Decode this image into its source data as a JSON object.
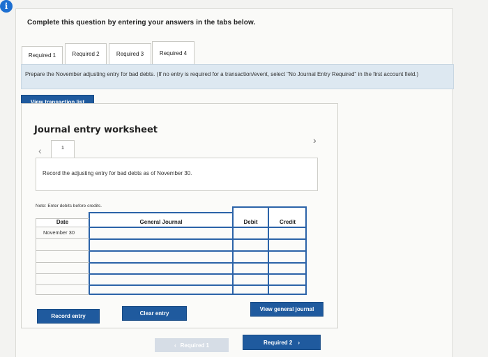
{
  "header": {
    "info_icon": "info-icon",
    "instruction": "Complete this question by entering your answers in the tabs below."
  },
  "tabs": [
    {
      "label": "Required 1",
      "active": true
    },
    {
      "label": "Required 2",
      "active": false
    },
    {
      "label": "Required 3",
      "active": false
    },
    {
      "label": "Required 4",
      "active": false
    }
  ],
  "prompt": {
    "text": "Prepare the November adjusting entry for bad debts. (If no entry is required for a transaction/event, select \"No Journal Entry Required\" in the first account field.)"
  },
  "buttons": {
    "view_transaction_list": "View transaction list",
    "record_entry": "Record entry",
    "clear_entry": "Clear entry",
    "view_general_journal": "View general journal",
    "prev_required": "Required 1",
    "next_required": "Required 2"
  },
  "worksheet": {
    "title": "Journal entry worksheet",
    "entry_number": "1",
    "entry_prompt": "Record the adjusting entry for bad debts as of November 30.",
    "note": "Note: Enter debits before credits.",
    "columns": {
      "date": "Date",
      "general_journal": "General Journal",
      "debit": "Debit",
      "credit": "Credit"
    },
    "rows": [
      {
        "date": "November 30",
        "account": "",
        "debit": "",
        "credit": ""
      },
      {
        "date": "",
        "account": "",
        "debit": "",
        "credit": ""
      },
      {
        "date": "",
        "account": "",
        "debit": "",
        "credit": ""
      },
      {
        "date": "",
        "account": "",
        "debit": "",
        "credit": ""
      },
      {
        "date": "",
        "account": "",
        "debit": "",
        "credit": ""
      },
      {
        "date": "",
        "account": "",
        "debit": "",
        "credit": ""
      }
    ]
  },
  "colors": {
    "primary_button": "#1f5a9e",
    "prompt_background": "#dde8f1",
    "grid_border": "#2b63a8",
    "disabled_button": "#d6dde6"
  }
}
